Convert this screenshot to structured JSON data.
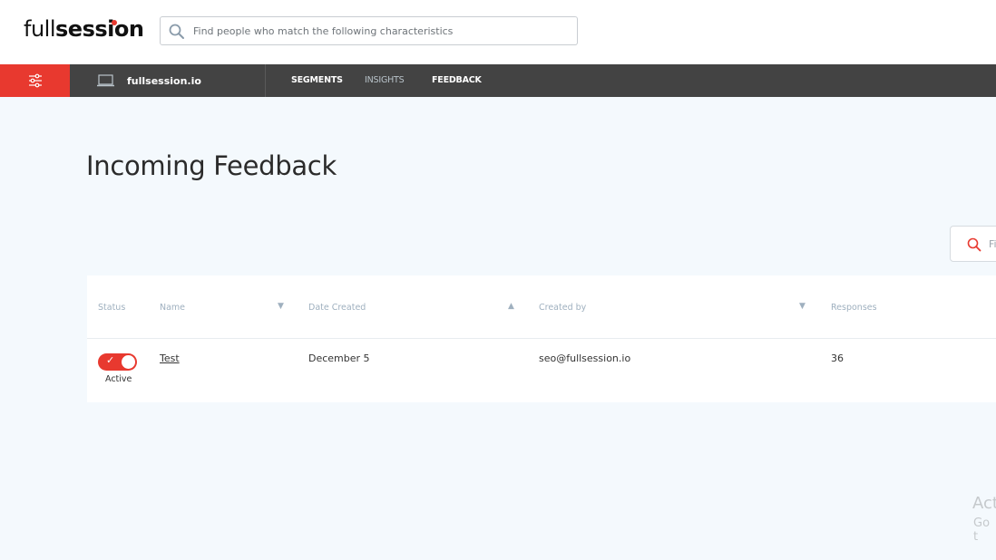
{
  "header": {
    "logo_full": "full",
    "logo_session": "session",
    "search_placeholder": "Find people who match the following characteristics"
  },
  "navbar": {
    "site_name": "fullsession.io",
    "items": [
      {
        "label": "SEGMENTS"
      },
      {
        "label": "INSIGHTS"
      },
      {
        "label": "FEEDBACK"
      }
    ]
  },
  "page": {
    "title": "Incoming Feedback",
    "table_search_placeholder": "Fi"
  },
  "table": {
    "headers": {
      "status": "Status",
      "name": "Name",
      "date_created": "Date Created",
      "created_by": "Created by",
      "responses": "Responses"
    },
    "sort_icons": {
      "name": "▼",
      "date_created": "▲",
      "created_by": "▼"
    },
    "rows": [
      {
        "status": "Active",
        "name": "Test",
        "date_created": "December 5",
        "created_by": "seo@fullsession.io",
        "responses": "36"
      }
    ]
  },
  "watermark": {
    "line1": "Act",
    "line2": "Go t"
  },
  "colors": {
    "accent": "#e8392f",
    "navbar": "#434343",
    "background": "#f4f9fd"
  }
}
